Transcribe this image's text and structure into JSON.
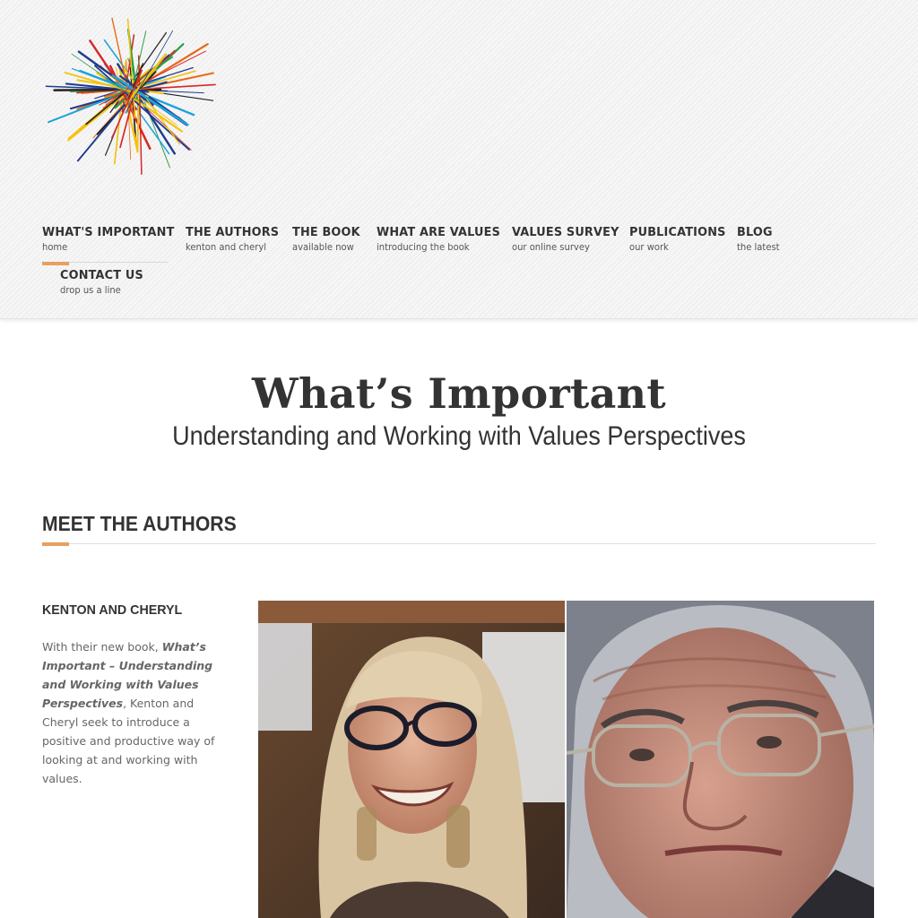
{
  "colors": {
    "accent": "#e8a060",
    "text": "#333333",
    "muted": "#666666",
    "header_bg": "#f3f3f3"
  },
  "logo": {
    "icon": "starburst-logo-icon"
  },
  "nav": [
    {
      "label": "WHAT'S IMPORTANT",
      "sub": "home",
      "active": true
    },
    {
      "label": "THE AUTHORS",
      "sub": "kenton and cheryl"
    },
    {
      "label": "THE BOOK",
      "sub": "available now"
    },
    {
      "label": "WHAT ARE VALUES",
      "sub": "introducing the book"
    },
    {
      "label": "VALUES SURVEY",
      "sub": "our online survey"
    },
    {
      "label": "PUBLICATIONS",
      "sub": "our work"
    },
    {
      "label": "BLOG",
      "sub": "the latest"
    },
    {
      "label": "CONTACT US",
      "sub": "drop us a line"
    }
  ],
  "hero": {
    "title": "What’s Important",
    "subtitle": "Understanding and Working with Values Perspectives"
  },
  "section": {
    "heading": "MEET THE AUTHORS"
  },
  "authors": {
    "name": "KENTON AND CHERYL",
    "desc_pre": "With their new book, ",
    "desc_book": "What’s Important – Understanding and Working with Values Perspectives",
    "desc_post": ", Kenton and Cheryl seek to introduce a positive and productive way of looking at and working with values.",
    "photos": [
      {
        "alt": "Cheryl portrait"
      },
      {
        "alt": "Kenton portrait"
      }
    ]
  }
}
